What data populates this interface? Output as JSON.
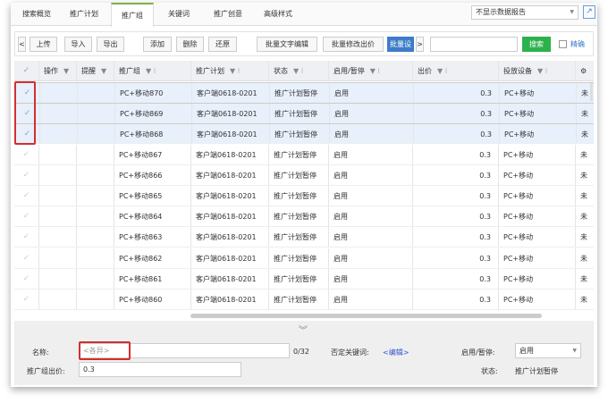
{
  "tabs": [
    "搜索概览",
    "推广计划",
    "推广组",
    "关键词",
    "推广创意",
    "高级样式"
  ],
  "active_tab": 2,
  "report_select": "不显示数据报告",
  "toolbar": {
    "prev": "<",
    "upload": "上传",
    "import": "导入",
    "export": "导出",
    "add": "添加",
    "delete": "删除",
    "restore": "还原",
    "batch_text": "批量文字编辑",
    "batch_bid": "批量修改出价",
    "batch_more": "批量设",
    "next": ">",
    "search_value": "",
    "search": "搜索",
    "precise": "精确"
  },
  "columns": [
    "操作",
    "提醒",
    "推广组",
    "推广计划",
    "状态",
    "启用/暂停",
    "出价",
    "投放设备"
  ],
  "rows": [
    {
      "checked": true,
      "group": "PC+移动870",
      "plan": "客户端0618-0201",
      "status": "推广计划暂停",
      "enabled": "启用",
      "bid": "0.3",
      "device": "PC+移动",
      "extra": "未"
    },
    {
      "checked": true,
      "group": "PC+移动869",
      "plan": "客户端0618-0201",
      "status": "推广计划暂停",
      "enabled": "启用",
      "bid": "0.3",
      "device": "PC+移动",
      "extra": "未"
    },
    {
      "checked": true,
      "group": "PC+移动868",
      "plan": "客户端0618-0201",
      "status": "推广计划暂停",
      "enabled": "启用",
      "bid": "0.3",
      "device": "PC+移动",
      "extra": "未"
    },
    {
      "checked": false,
      "group": "PC+移动867",
      "plan": "客户端0618-0201",
      "status": "推广计划暂停",
      "enabled": "启用",
      "bid": "0.3",
      "device": "PC+移动",
      "extra": "未"
    },
    {
      "checked": false,
      "group": "PC+移动866",
      "plan": "客户端0618-0201",
      "status": "推广计划暂停",
      "enabled": "启用",
      "bid": "0.3",
      "device": "PC+移动",
      "extra": "未"
    },
    {
      "checked": false,
      "group": "PC+移动865",
      "plan": "客户端0618-0201",
      "status": "推广计划暂停",
      "enabled": "启用",
      "bid": "0.3",
      "device": "PC+移动",
      "extra": "未"
    },
    {
      "checked": false,
      "group": "PC+移动864",
      "plan": "客户端0618-0201",
      "status": "推广计划暂停",
      "enabled": "启用",
      "bid": "0.3",
      "device": "PC+移动",
      "extra": "未"
    },
    {
      "checked": false,
      "group": "PC+移动863",
      "plan": "客户端0618-0201",
      "status": "推广计划暂停",
      "enabled": "启用",
      "bid": "0.3",
      "device": "PC+移动",
      "extra": "未"
    },
    {
      "checked": false,
      "group": "PC+移动862",
      "plan": "客户端0618-0201",
      "status": "推广计划暂停",
      "enabled": "启用",
      "bid": "0.3",
      "device": "PC+移动",
      "extra": "未"
    },
    {
      "checked": false,
      "group": "PC+移动861",
      "plan": "客户端0618-0201",
      "status": "推广计划暂停",
      "enabled": "启用",
      "bid": "0.3",
      "device": "PC+移动",
      "extra": "未"
    },
    {
      "checked": false,
      "group": "PC+移动860",
      "plan": "客户端0618-0201",
      "status": "推广计划暂停",
      "enabled": "启用",
      "bid": "0.3",
      "device": "PC+移动",
      "extra": "未"
    }
  ],
  "panel": {
    "name_label": "名称:",
    "name_placeholder": "<各异>",
    "name_count": "0/32",
    "neg_kw_label": "否定关键词:",
    "neg_kw_link": "<编辑>",
    "enable_label": "启用/暂停:",
    "enable_value": "启用",
    "bid_label": "推广组出价:",
    "bid_value": "0.3",
    "status_label": "状态:",
    "status_value": "推广计划暂停"
  }
}
